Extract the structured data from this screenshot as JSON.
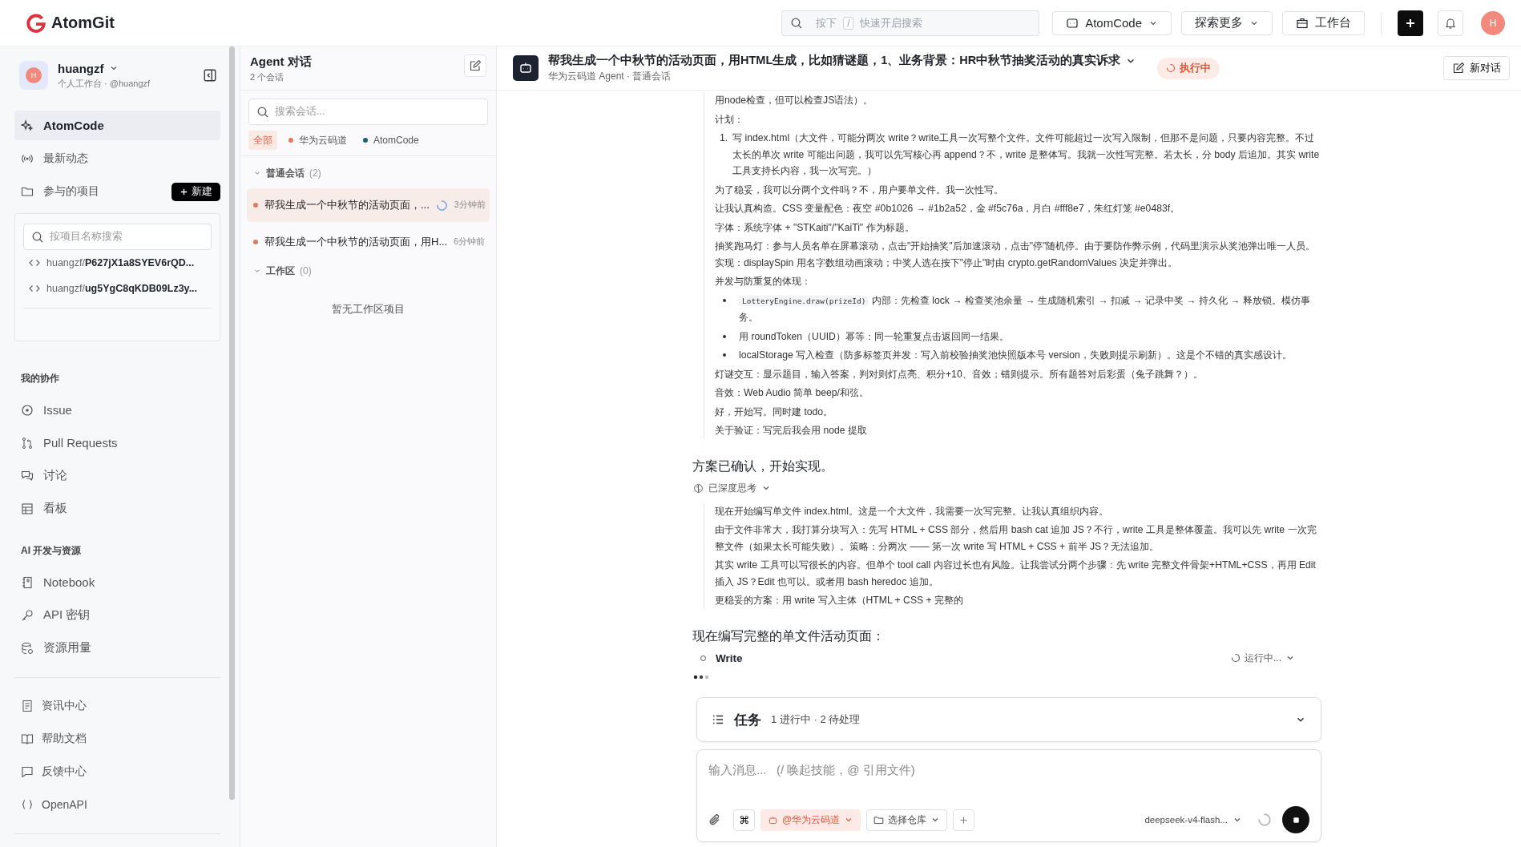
{
  "topbar": {
    "brand": "AtomGit",
    "search": {
      "prefix": "按下",
      "shortcut": "/",
      "placeholder": "快速开启搜索"
    },
    "buttons": [
      {
        "label": "AtomCode",
        "kind": "agent"
      },
      {
        "label": "探索更多",
        "kind": "dropdown"
      },
      {
        "label": "工作台",
        "kind": "briefcase"
      }
    ],
    "avatar": "H"
  },
  "sidebar": {
    "user": {
      "name": "huangzf",
      "subtitle": "个人工作台 · @huangzf",
      "avatar": "H"
    },
    "nav": [
      {
        "label": "AtomCode",
        "selected": true
      },
      {
        "label": "最新动态",
        "selected": false
      }
    ],
    "projects": {
      "label": "参与的项目",
      "new_button": "新建",
      "search_placeholder": "按项目名称搜索",
      "items": [
        {
          "owner": "huangzf/",
          "name": "P627jX1a8SYEV6rQD..."
        },
        {
          "owner": "huangzf/",
          "name": "ug5YgC8qKDB09Lz3y..."
        }
      ]
    },
    "sections": [
      {
        "title": "我的协作",
        "items": [
          {
            "label": "Issue",
            "selected": false
          },
          {
            "label": "Pull Requests",
            "selected": false
          },
          {
            "label": "讨论",
            "selected": false
          },
          {
            "label": "看板",
            "selected": false
          }
        ]
      },
      {
        "title": "AI 开发与资源",
        "items": [
          {
            "label": "Notebook",
            "selected": false
          },
          {
            "label": "API 密钥",
            "selected": false
          },
          {
            "label": "资源用量",
            "selected": false
          }
        ]
      }
    ],
    "footer": [
      {
        "label": "资讯中心",
        "selected": false
      },
      {
        "label": "帮助文档",
        "selected": false
      },
      {
        "label": "反馈中心",
        "selected": false
      },
      {
        "label": "OpenAPI",
        "selected": false
      }
    ]
  },
  "agent_panel": {
    "title": "Agent 对话",
    "count": "2 个会话",
    "search": {
      "placeholder": "搜索会话..."
    },
    "filters": [
      {
        "label": "全部",
        "selected": true
      },
      {
        "label": "华为云码道",
        "selected": false,
        "color": "#e07a5f"
      },
      {
        "label": "AtomCode",
        "selected": false,
        "color": "#1f5f74"
      }
    ],
    "groups": [
      {
        "title": "普通会话",
        "count": "(2)",
        "expanded": true,
        "sessions": [
          {
            "title": "帮我生成一个中秋节的活动页面，...",
            "time": "3分钟前",
            "running": true,
            "selected": true,
            "color": "#e07a5f"
          },
          {
            "title": "帮我生成一个中秋节的活动页面，用H...",
            "time": "6分钟前",
            "running": false,
            "selected": false,
            "color": "#e07a5f"
          }
        ]
      },
      {
        "title": "工作区",
        "count": "(0)",
        "expanded": true,
        "empty": "暂无工作区项目"
      }
    ]
  },
  "chat": {
    "title": "帮我生成一个中秋节的活动页面，用HTML生成，比如猜谜题，1、业务背景：HR中秋节抽奖活动的真实诉求",
    "subtitle": "华为云码道 Agent · 普通会话",
    "status": "执行中",
    "new_chat": "新对话",
    "blocks": [
      {
        "kind": "thinking",
        "parts": [
          {
            "kind": "p",
            "text": "用node检查，但可以检查JS语法）。"
          },
          {
            "kind": "p",
            "text": "计划："
          },
          {
            "kind": "ol",
            "items": [
              {
                "number": "1.",
                "text": "写 index.html（大文件，可能分两次 write？write工具一次写整个文件。文件可能超过一次写入限制，但那不是问题，只要内容完整。不过太长的单次 write 可能出问题，我可以先写核心再 append？不，write 是整体写。我就一次性写完整。若太长，分 body 后追加。其实 write 工具支持长内容，我一次写完。）"
              }
            ]
          },
          {
            "kind": "p",
            "text": "为了稳妥，我可以分两个文件吗？不，用户要单文件。我一次性写。"
          },
          {
            "kind": "p",
            "text": "让我认真构造。CSS 变量配色：夜空 #0b1026 → #1b2a52，金 #f5c76a，月白 #fff8e7，朱红灯笼 #e0483f。"
          },
          {
            "kind": "p",
            "text": "字体：系统字体 + \"STKaiti\"/\"KaiTi\" 作为标题。"
          },
          {
            "kind": "p",
            "text": "抽奖跑马灯：参与人员名单在屏幕滚动，点击\"开始抽奖\"后加速滚动，点击\"停\"随机停。由于要防作弊示例，代码里演示从奖池弹出唯一人员。实现：displaySpin 用名字数组动画滚动；中奖人选在按下\"停止\"时由 crypto.getRandomValues 决定并弹出。"
          },
          {
            "kind": "p",
            "text": "并发与防重复的体现："
          },
          {
            "kind": "ul",
            "items": [
              {
                "code": "LotteryEngine.draw(prizeId)",
                "text": " 内部：先检查 lock → 检查奖池余量 → 生成随机索引 → 扣减 → 记录中奖 → 持久化 → 释放锁。模仿事务。"
              },
              {
                "text": "用 roundToken（UUID）幂等：同一轮重复点击返回同一结果。"
              },
              {
                "text": "localStorage 写入检查（防多标签页并发：写入前校验抽奖池快照版本号 version，失败则提示刷新）。这是个不错的真实感设计。"
              }
            ]
          },
          {
            "kind": "p",
            "text": "灯谜交互：显示题目，输入答案，判对则灯点亮、积分+10、音效；错则提示。所有题答对后彩蛋（兔子跳舞？）。"
          },
          {
            "kind": "p",
            "text": "音效：Web Audio 简单 beep/和弦。"
          },
          {
            "kind": "p",
            "text": "好，开始写。同时建 todo。"
          },
          {
            "kind": "p",
            "text": "关于验证：写完后我会用 node 提取"
          }
        ]
      },
      {
        "kind": "heading",
        "text": "方案已确认，开始实现。"
      },
      {
        "kind": "toggle",
        "label": "已深度思考",
        "expanded": true
      },
      {
        "kind": "thinking",
        "parts": [
          {
            "kind": "p",
            "text": "现在开始编写单文件 index.html。这是一个大文件，我需要一次写完整。让我认真组织内容。"
          },
          {
            "kind": "p",
            "text": "由于文件非常大，我打算分块写入：先写 HTML + CSS 部分，然后用 bash cat 追加 JS？不行，write 工具是整体覆盖。我可以先 write 一次完整文件（如果太长可能失败）。策略：分两次 —— 第一次 write 写 HTML + CSS + 前半 JS？无法追加。"
          },
          {
            "kind": "p",
            "text": "其实 write 工具可以写很长的内容。但单个 tool call 内容过长也有风险。让我尝试分两个步骤：先 write 完整文件骨架+HTML+CSS，再用 Edit 插入 JS？Edit 也可以。或者用 bash heredoc 追加。"
          },
          {
            "kind": "p",
            "text": "更稳妥的方案：用 write 写入主体（HTML + CSS + 完整的"
          }
        ]
      },
      {
        "kind": "heading",
        "text": "现在编写完整的单文件活动页面："
      },
      {
        "kind": "tool",
        "name": "Write",
        "status": "运行中...",
        "running": true
      },
      {
        "kind": "typing"
      }
    ],
    "tasks": {
      "title": "任务",
      "summary": "1 进行中 · 2 待处理",
      "expanded": false
    },
    "composer": {
      "placeholder": "输入消息...   (/ 唤起技能，@ 引用文件)",
      "command_key": "⌘",
      "agent": "@华为云码道",
      "repo": "选择仓库",
      "model": "deepseek-v4-flash...",
      "generating": true
    }
  }
}
